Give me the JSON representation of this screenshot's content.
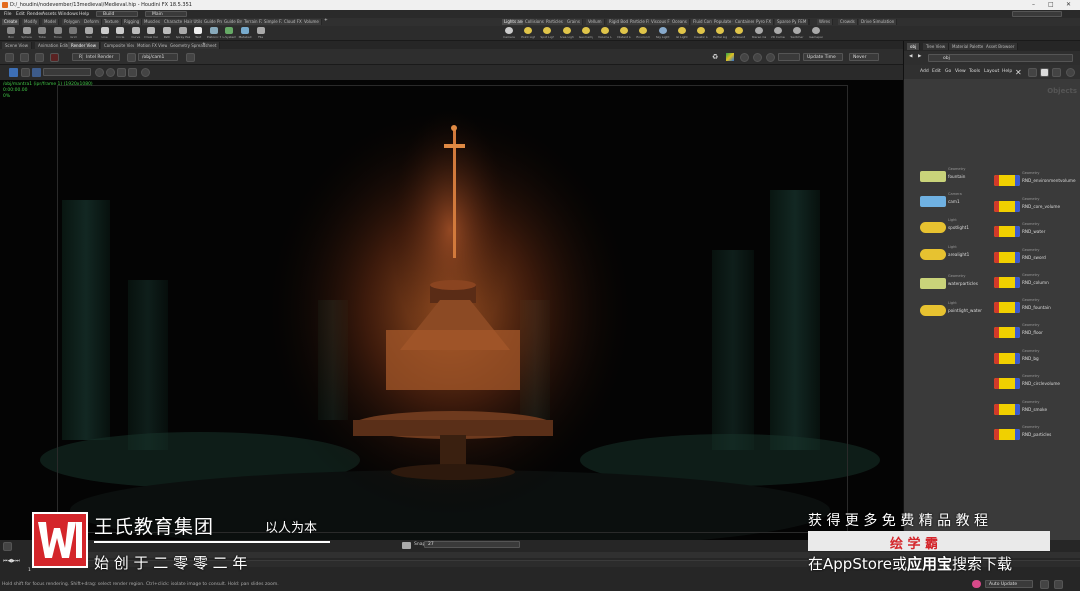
{
  "window": {
    "title": "D:/_houdini/nodevember/13medieval/Medieval.hip - Houdini FX 18.5.351",
    "min": "–",
    "max": "□",
    "close": "✕"
  },
  "menubar": {
    "items": [
      "File",
      "Edit",
      "Render",
      "Assets",
      "Windows",
      "Help"
    ],
    "desktop": "Build",
    "object": "Main"
  },
  "shelf_tabs_left": [
    "Create",
    "Modify",
    "Model",
    "Polygon",
    "Deform",
    "Texture",
    "Rigging",
    "Muscles",
    "Characters",
    "Hair Utils",
    "Guide Process",
    "Guide Brushes",
    "Terrain FX",
    "Simple FX",
    "Cloud FX",
    "Volume"
  ],
  "shelf_tabs_right": [
    "Lights and Cameras",
    "Collisions",
    "Particles",
    "Grains",
    "Vellum",
    "Rigid Bodies",
    "Particle Fluids",
    "Viscous Fluids",
    "Oceans",
    "Fluid Containers",
    "Populate Containers",
    "Container Tools",
    "Pyro FX",
    "Sparse Pyro FX",
    "FEM",
    "Wires",
    "Crowds",
    "Drive Simulation"
  ],
  "tools_left": [
    "Box",
    "Sphere",
    "Tube",
    "Torus",
    "Grid",
    "Null",
    "Line",
    "Circle",
    "Curve",
    "Draw Curve",
    "Path",
    "Spray Paint",
    "Text",
    "Platonic Solids",
    "L-System",
    "Metaball",
    "File"
  ],
  "tools_right": [
    "Camera",
    "Point Light",
    "Spot Light",
    "Area Light",
    "Geometry Light",
    "Volume Light",
    "Distant Light",
    "Environment Light",
    "Sky Light",
    "GI Light",
    "Caustic Light",
    "Portal Light",
    "Ambient Light",
    "Stereo Camera",
    "VR Camera",
    "Switcher",
    "Gamepad Camera"
  ],
  "pane_tabs": [
    "Scene View",
    "Animation Editor",
    "Render View",
    "Composite View",
    "Motion FX View",
    "Geometry Spreadsheet"
  ],
  "render_toolbar": {
    "render_btn": "Render",
    "renderer": "Intel Render",
    "camera": "/obj/cam1",
    "update": "Update Time",
    "status": "Never"
  },
  "viewport": {
    "info_line1": "/obj/mantra1 (ipr/frame 1)  (1920x1080)",
    "info_line2": "0:00:00.00",
    "info_line3": "0%"
  },
  "right_pane": {
    "tabs": [
      "obj",
      "Tree View",
      "Material Palette",
      "Asset Browser"
    ],
    "path": "obj",
    "menu": [
      "Add",
      "Edit",
      "Go",
      "View",
      "Tools",
      "Layout",
      "Help"
    ],
    "context": "Objects"
  },
  "nodes_left": [
    {
      "name": "fountain",
      "type": "Geometry",
      "kind": "geo"
    },
    {
      "name": "cam1",
      "type": "Camera",
      "kind": "cam"
    },
    {
      "name": "spotlight1",
      "type": "Light",
      "kind": "light"
    },
    {
      "name": "arealight1",
      "type": "Light",
      "kind": "light"
    },
    {
      "name": "waterparticles",
      "type": "Geometry",
      "kind": "geo"
    },
    {
      "name": "pointlight_water",
      "type": "Light",
      "kind": "light"
    }
  ],
  "nodes_right": [
    {
      "name": "RND_environmentvolume",
      "type": "Geometry"
    },
    {
      "name": "RND_core_volume",
      "type": "Geometry"
    },
    {
      "name": "RND_water",
      "type": "Geometry"
    },
    {
      "name": "RND_sword",
      "type": "Geometry"
    },
    {
      "name": "RND_column",
      "type": "Geometry"
    },
    {
      "name": "RND_fountain",
      "type": "Geometry"
    },
    {
      "name": "RND_floor",
      "type": "Geometry"
    },
    {
      "name": "RND_bg",
      "type": "Geometry"
    },
    {
      "name": "RND_circlevolume",
      "type": "Geometry"
    },
    {
      "name": "RND_smoke",
      "type": "Geometry"
    },
    {
      "name": "RND_particles",
      "type": "Geometry"
    }
  ],
  "timeline": {
    "snap_label": "Snap",
    "snap_value": "27",
    "frame": "1",
    "status_text": "Hold shift for focus rendering. Shift+drag: select render region. Ctrl+click: isolate image to consult. Hold: pan slides zoom.",
    "auto_update": "Auto Update"
  },
  "watermark": {
    "brand": "王氏教育集团",
    "slogan": "以人为本",
    "founded": "始 创 于 二 零 零 二 年",
    "promo1": "获 得 更 多 免 费 精 品 教 程",
    "promo2_box": "绘 学 霸",
    "promo3_pre": "在",
    "promo3_app": "AppStore",
    "promo3_or": "或",
    "promo3_store": "应用宝",
    "promo3_post": "搜索下载"
  },
  "colors": {
    "geo": "#c9d37a",
    "cam": "#6fb1e2",
    "light": "#e7c230",
    "rnd": "#f0d000",
    "rnd_red": "#d13a2a",
    "rnd_blue": "#3a5bd1",
    "brand_red": "#d4262b"
  }
}
